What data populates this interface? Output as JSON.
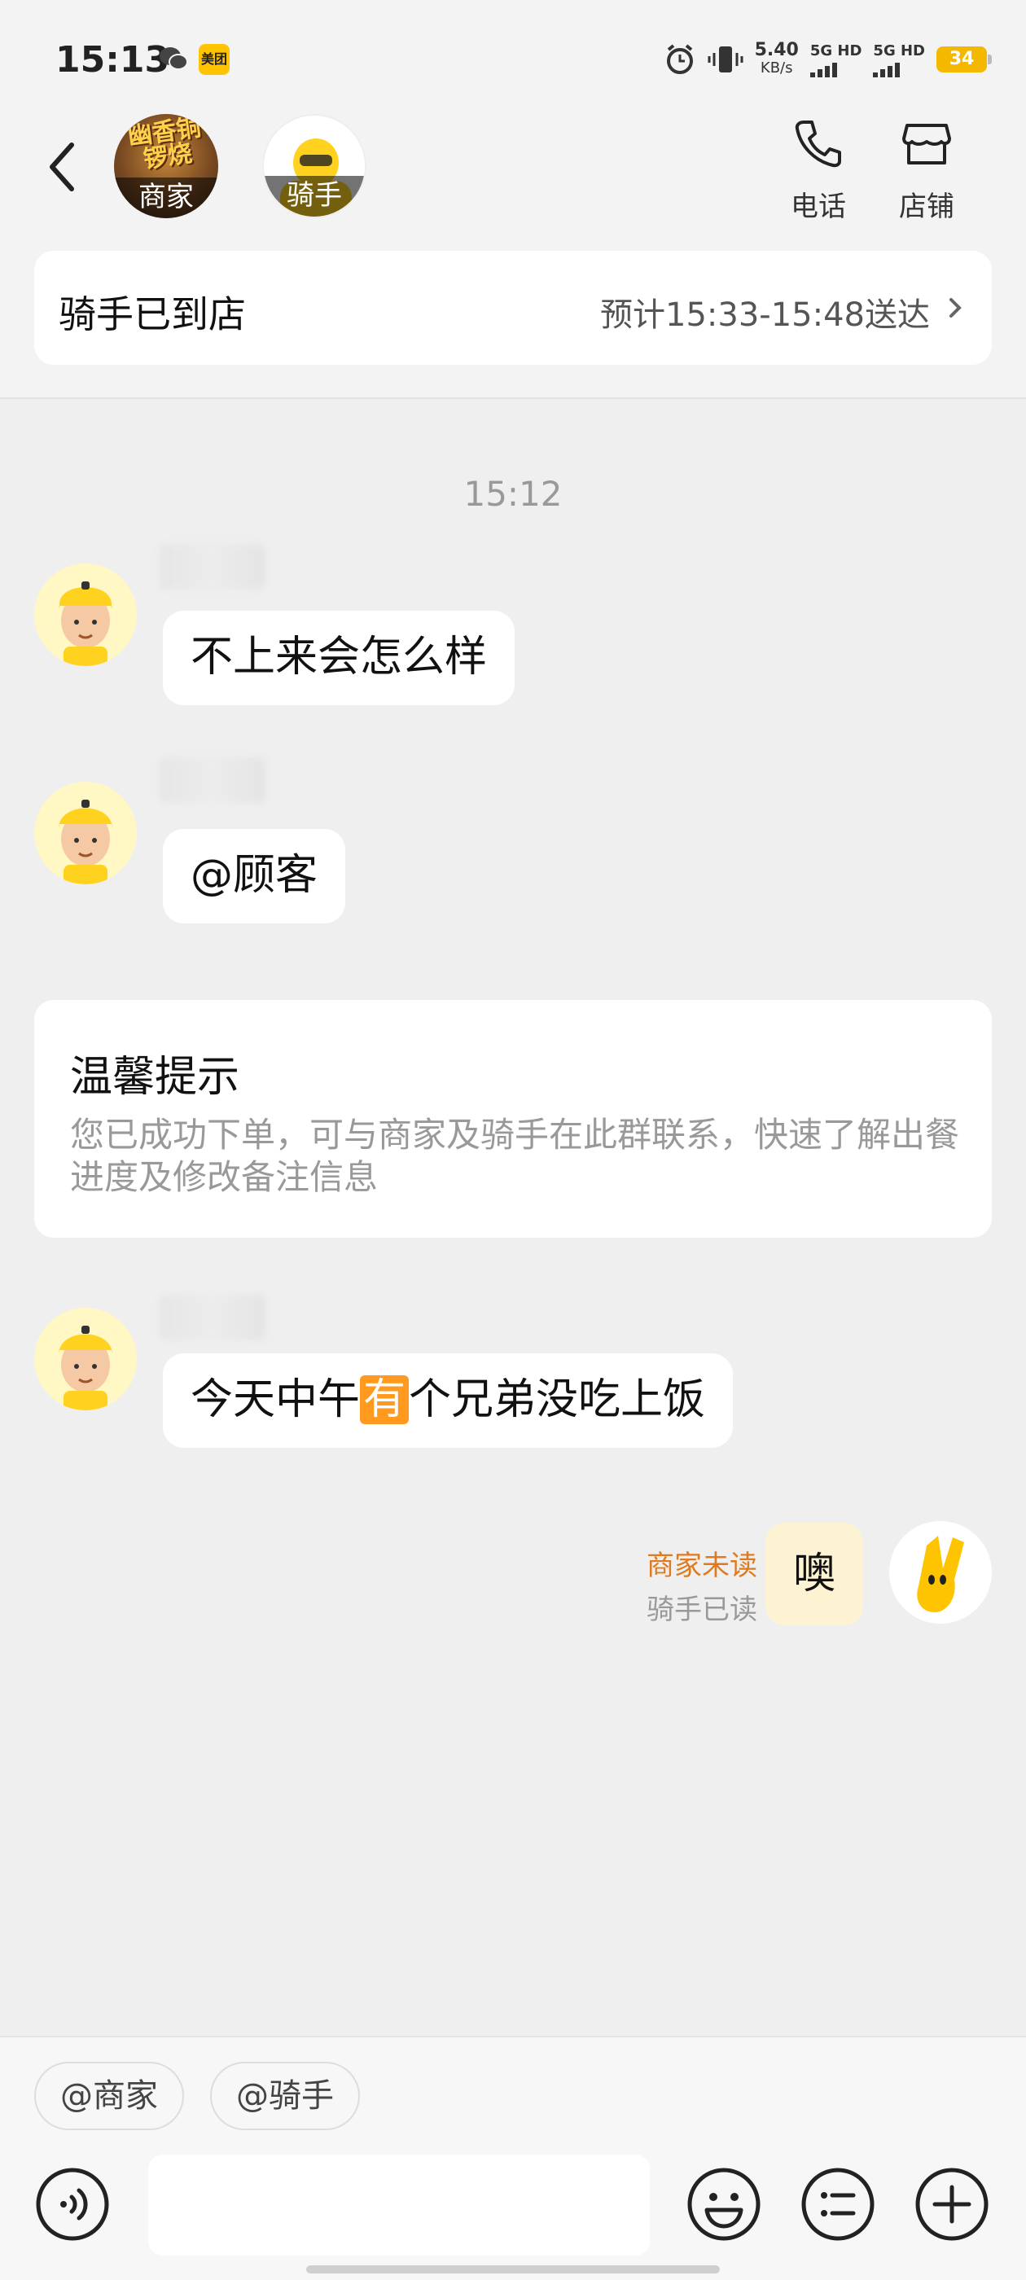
{
  "status_bar": {
    "time": "15:13",
    "app_badge": "美团",
    "net_speed_value": "5.40",
    "net_speed_unit": "KB/s",
    "sim1": "5G HD",
    "sim2": "5G HD",
    "battery": "34"
  },
  "header": {
    "merchant_avatar_label": "商家",
    "merchant_avatar_text": "幽香铜锣烧",
    "rider_avatar_label": "骑手",
    "phone_label": "电话",
    "store_label": "店铺"
  },
  "rider_card": {
    "status": "骑手已到店",
    "eta": "预计15:33-15:48送达"
  },
  "chat": {
    "time_separator": "15:12",
    "messages": [
      {
        "text": "不上来会怎么样"
      },
      {
        "text": "@顾客"
      }
    ],
    "tip": {
      "title": "温馨提示",
      "body": "您已成功下单，可与商家及骑手在此群联系，快速了解出餐进度及修改备注信息"
    },
    "message3": {
      "before": "今天中午",
      "highlight": "有",
      "after": "个兄弟没吃上饭"
    },
    "self_message": {
      "text": "噢",
      "merchant_status": "商家未读",
      "rider_status": "骑手已读"
    }
  },
  "input": {
    "mention_merchant": "@商家",
    "mention_rider": "@骑手",
    "placeholder": ""
  },
  "colors": {
    "accent_orange": "#e07a1f",
    "highlight": "#ff9a1f",
    "self_bubble": "#fdf3d3",
    "battery": "#f5b800"
  }
}
